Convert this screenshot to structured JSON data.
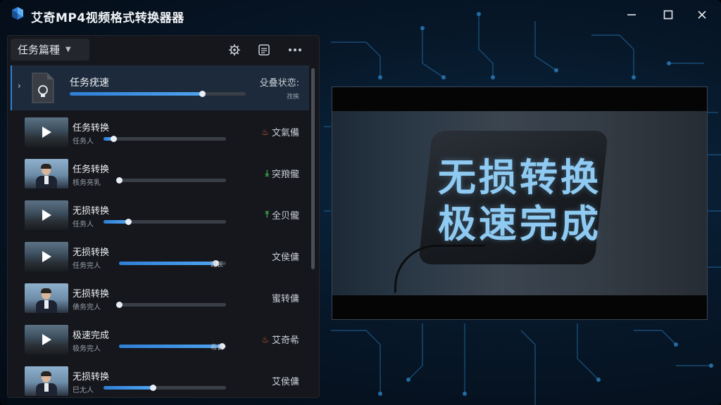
{
  "window": {
    "title": "艾奇MP4视频格式转换器器",
    "controls": {
      "minimize_icon": "minimize-icon",
      "maximize_icon": "maximize-icon",
      "close_icon": "close-icon"
    }
  },
  "toolbar": {
    "task_dropdown_label": "任务篇種",
    "icons": [
      "settings-icon",
      "list-icon",
      "more-icon"
    ]
  },
  "active_task": {
    "name": "任务疣速",
    "status_label": "殳叠状恋:",
    "state_text": "孜挨",
    "progress": 0.75
  },
  "tasks": [
    {
      "name": "任务转换",
      "sub": "任务⼈",
      "status": "文氣備",
      "status_icon": "flame-icon",
      "icon_color": "#e0623a",
      "thumb": "road",
      "progress": 0.08,
      "extra": ""
    },
    {
      "name": "任务转换",
      "sub": "核务亮乳",
      "status": "突羪儱",
      "status_icon": "download-icon",
      "icon_color": "#3fb34f",
      "thumb": "person",
      "progress": 0.0,
      "extra": ""
    },
    {
      "name": "无损转换",
      "sub": "任务⼈",
      "status": "全贝儱",
      "status_icon": "upload-icon",
      "icon_color": "#3fb34f",
      "thumb": "road",
      "progress": 0.2,
      "extra": ""
    },
    {
      "name": "无损转换",
      "sub": "任务完⼈",
      "status": "文侯傭",
      "status_icon": "",
      "icon_color": "",
      "thumb": "road",
      "progress": 0.9,
      "extra": "斑⻓"
    },
    {
      "name": "无损转换",
      "sub": "俵务完⼈",
      "status": "蜜转傭",
      "status_icon": "",
      "icon_color": "",
      "thumb": "person",
      "progress": 0.0,
      "extra": ""
    },
    {
      "name": "极速完成",
      "sub": "极务完⼈",
      "status": "艾奇㣇",
      "status_icon": "flame-icon",
      "icon_color": "#e0623a",
      "thumb": "road",
      "progress": 0.96,
      "extra": "㣇⻓"
    },
    {
      "name": "无损转换",
      "sub": "⺒⺐⼈",
      "status": "艾侯傭",
      "status_icon": "",
      "icon_color": "",
      "thumb": "person",
      "progress": 0.4,
      "extra": ""
    }
  ],
  "preview": {
    "headline_line1": "无损转换",
    "headline_line2": "极速完成"
  },
  "colors": {
    "accent": "#2f7fd6",
    "accent_light": "#4fa3ef",
    "panel_bg": "#15171c",
    "headline": "#8fcaf2"
  }
}
